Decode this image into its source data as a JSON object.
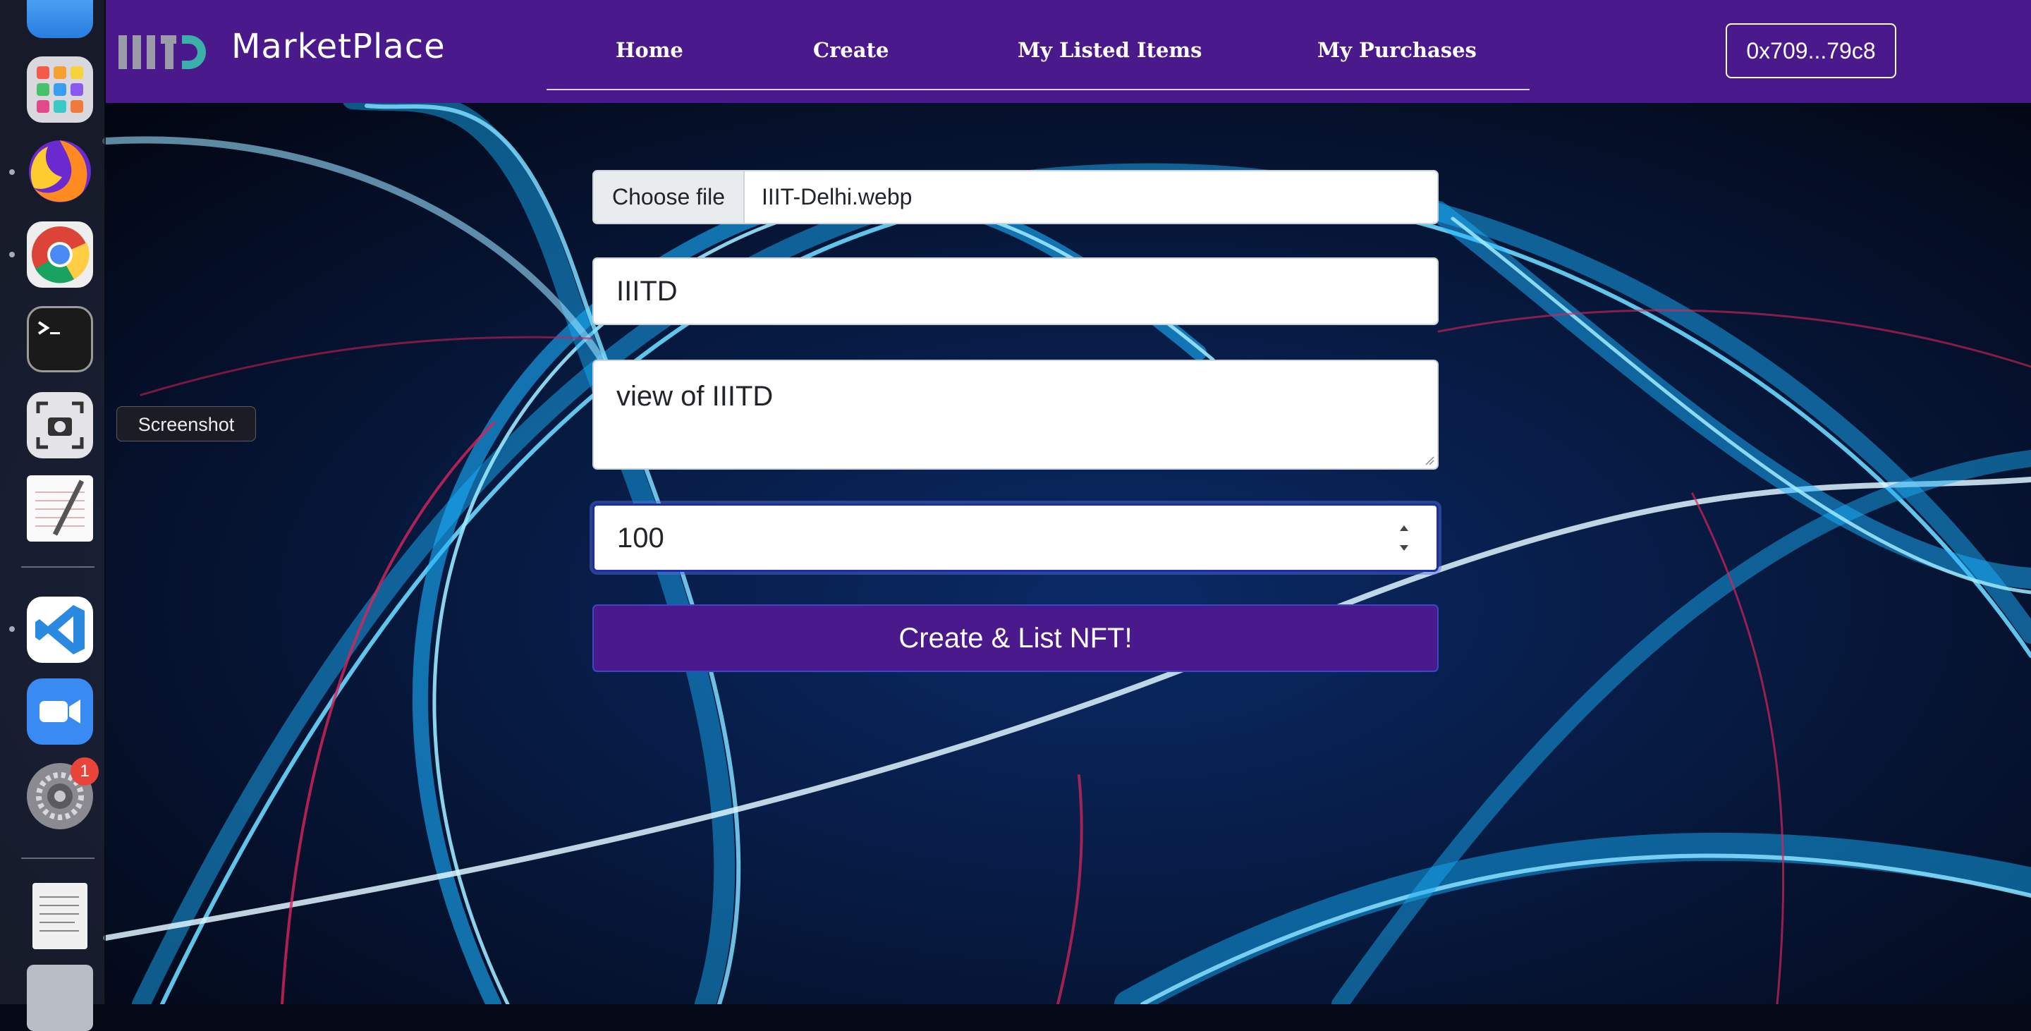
{
  "dock": {
    "tooltip": "Screenshot",
    "notification_badge": "1",
    "apps": [
      "finder-icon",
      "launchpad-icon",
      "firefox-icon",
      "chrome-icon",
      "terminal-icon",
      "screenshot-icon",
      "textedit-icon",
      "vscode-icon",
      "zoom-icon",
      "system-preferences-icon",
      "document-icon",
      "trash-icon"
    ]
  },
  "navbar": {
    "brand": "MarketPlace",
    "links": [
      "Home",
      "Create",
      "My Listed Items",
      "My Purchases"
    ],
    "wallet": "0x709...79c8",
    "color": "#4a1a8c"
  },
  "form": {
    "choose_file_label": "Choose file",
    "file_name": "IIIT-Delhi.webp",
    "name_value": "IIITD",
    "description_value": "view of IIITD",
    "price_value": "100",
    "submit_label": "Create & List NFT!"
  }
}
